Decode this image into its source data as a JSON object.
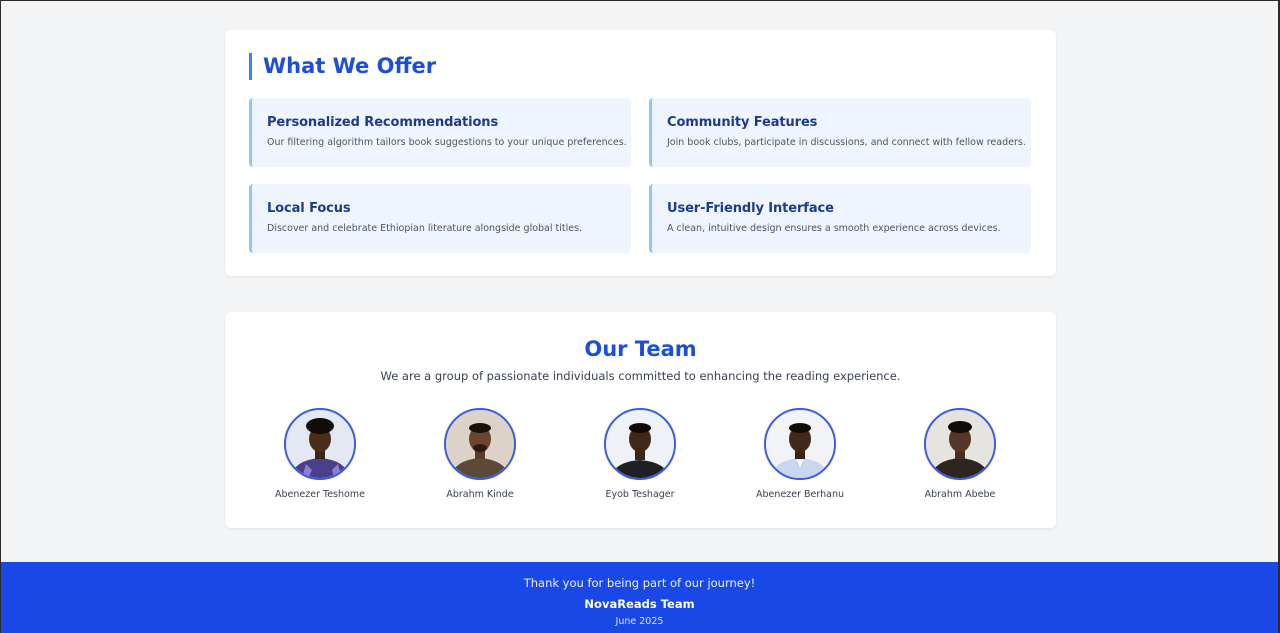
{
  "offer": {
    "title": "What We Offer",
    "features": [
      {
        "title": "Personalized Recommendations",
        "description": "Our filtering algorithm tailors book suggestions to your unique preferences."
      },
      {
        "title": "Community Features",
        "description": "Join book clubs, participate in discussions, and connect with fellow readers."
      },
      {
        "title": "Local Focus",
        "description": "Discover and celebrate Ethiopian literature alongside global titles."
      },
      {
        "title": "User-Friendly Interface",
        "description": "A clean, intuitive design ensures a smooth experience across devices."
      }
    ]
  },
  "team": {
    "title": "Our Team",
    "subtitle": "We are a group of passionate individuals committed to enhancing the reading experience.",
    "members": [
      {
        "name": "Abenezer Teshome",
        "avatar_icon": "profile-photo"
      },
      {
        "name": "Abrahm Kinde",
        "avatar_icon": "profile-photo"
      },
      {
        "name": "Eyob Teshager",
        "avatar_icon": "profile-photo"
      },
      {
        "name": "Abenezer Berhanu",
        "avatar_icon": "profile-photo"
      },
      {
        "name": "Abrahm Abebe",
        "avatar_icon": "profile-photo"
      }
    ]
  },
  "footer": {
    "thanks": "Thank you for being part of our journey!",
    "team_name": "NovaReads Team",
    "date": "June 2025"
  },
  "colors": {
    "accent": "#1d4ed8",
    "footer_bg": "#1a48e6",
    "feature_bg": "#eef5ff",
    "page_bg": "#f3f4f6"
  }
}
